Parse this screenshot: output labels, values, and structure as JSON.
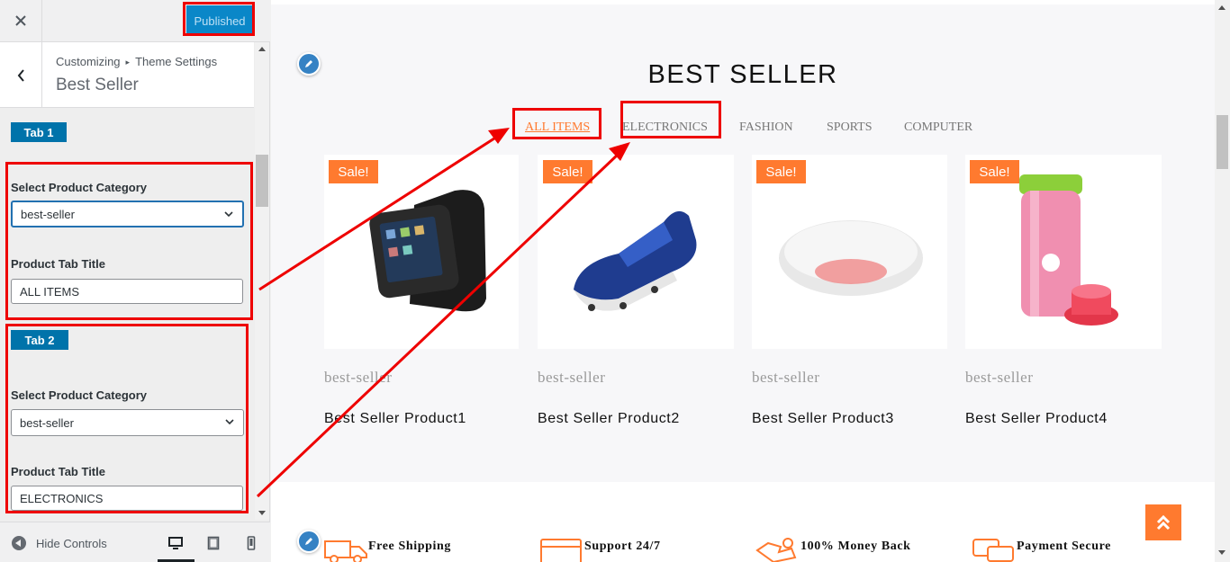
{
  "customizer": {
    "close_icon": "close-icon",
    "publish_label": "Published",
    "breadcrumb": {
      "parent": "Customizing",
      "separator": "▸",
      "current": "Theme Settings"
    },
    "section_title": "Best Seller",
    "tabs": [
      {
        "badge": "Tab 1",
        "category_label": "Select Product Category",
        "category_value": "best-seller",
        "title_label": "Product Tab Title",
        "title_value": "ALL ITEMS"
      },
      {
        "badge": "Tab 2",
        "category_label": "Select Product Category",
        "category_value": "best-seller",
        "title_label": "Product Tab Title",
        "title_value": "ELECTRONICS"
      }
    ],
    "footer": {
      "hide_controls": "Hide Controls",
      "devices": [
        "desktop-icon",
        "tablet-icon",
        "mobile-icon"
      ]
    }
  },
  "preview": {
    "section_title": "BEST SELLER",
    "filter_tabs": [
      "ALL ITEMS",
      "ELECTRONICS",
      "FASHION",
      "SPORTS",
      "COMPUTER"
    ],
    "active_tab": "ALL ITEMS",
    "products": [
      {
        "badge": "Sale!",
        "category": "best-seller",
        "name": "Best Seller Product1",
        "image": "smartwatch-image"
      },
      {
        "badge": "Sale!",
        "category": "best-seller",
        "name": "Best Seller Product2",
        "image": "soccer-shoe-image"
      },
      {
        "badge": "Sale!",
        "category": "best-seller",
        "name": "Best Seller Product3",
        "image": "mouse-image"
      },
      {
        "badge": "Sale!",
        "category": "best-seller",
        "name": "Best Seller Product4",
        "image": "bottle-image"
      }
    ],
    "features": [
      {
        "title": "Free Shipping",
        "icon": "truck-icon"
      },
      {
        "title": "Support 24/7",
        "icon": "support-icon"
      },
      {
        "title": "100% Money Back",
        "icon": "money-back-icon"
      },
      {
        "title": "Payment Secure",
        "icon": "chat-icon"
      }
    ]
  },
  "colors": {
    "accent": "#ff7a2f",
    "wp_blue": "#0073aa",
    "highlight": "#ee0000"
  }
}
